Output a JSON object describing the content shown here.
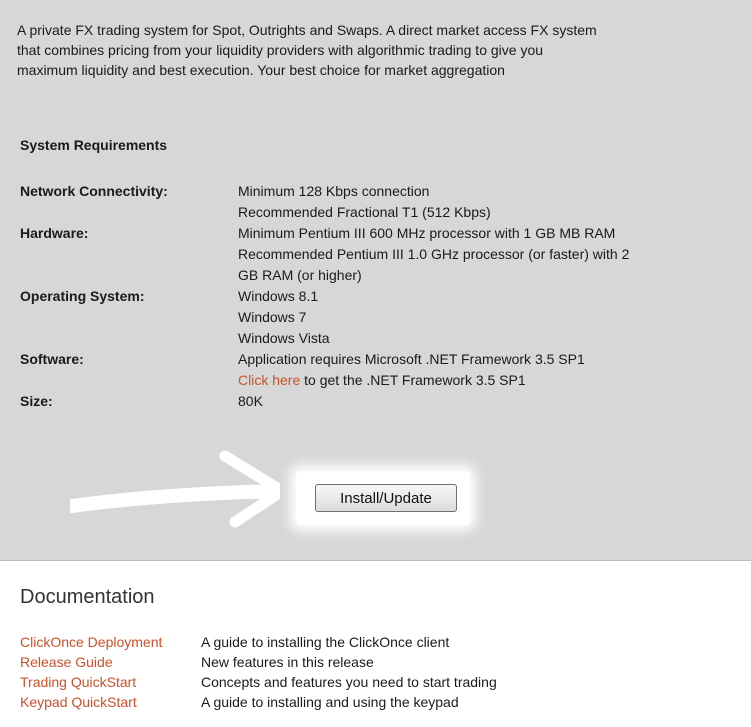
{
  "intro": {
    "lines": [
      "A private FX trading system for Spot, Outrights and Swaps. A direct market access FX system",
      "that combines pricing from your liquidity providers with algorithmic trading to give you",
      "maximum liquidity and best execution. Your best choice for market aggregation"
    ]
  },
  "system_requirements": {
    "heading": "System Requirements",
    "network": {
      "label": "Network Connectivity:",
      "lines": [
        "Minimum 128 Kbps connection",
        "Recommended Fractional T1 (512 Kbps)"
      ]
    },
    "hardware": {
      "label": "Hardware:",
      "lines": [
        "Minimum Pentium III 600 MHz processor with 1 GB MB RAM",
        "Recommended Pentium III 1.0 GHz processor (or faster) with 2",
        "GB RAM (or higher)"
      ]
    },
    "os": {
      "label": "Operating System:",
      "lines": [
        "Windows 8.1",
        "Windows 7",
        "Windows Vista"
      ]
    },
    "software": {
      "label": "Software:",
      "line1": "Application requires Microsoft .NET Framework 3.5 SP1",
      "link_text": "Click here",
      "link_suffix": " to get the .NET Framework 3.5 SP1"
    },
    "size": {
      "label": "Size:",
      "value": "80K"
    }
  },
  "install": {
    "button_label": "Install/Update",
    "arrow_icon": "right-arrow-icon"
  },
  "documentation": {
    "title": "Documentation",
    "items": [
      {
        "link": "ClickOnce Deployment",
        "description": "A guide to installing the ClickOnce client"
      },
      {
        "link": "Release Guide",
        "description": "New features in this release"
      },
      {
        "link": "Trading QuickStart",
        "description": "Concepts and features you need to start trading"
      },
      {
        "link": "Keypad QuickStart",
        "description": "A guide to installing and using the keypad"
      }
    ]
  },
  "colors": {
    "panel_background": "#d7d7d7",
    "link": "#c8522a",
    "text": "#1a1a1a"
  }
}
